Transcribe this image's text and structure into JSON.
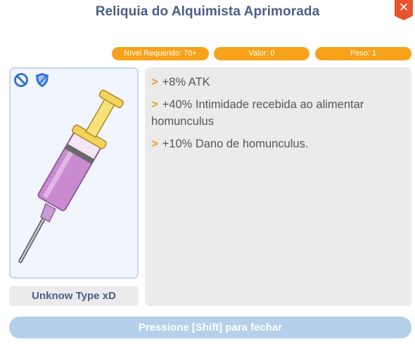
{
  "window": {
    "title": "Reliquia do Alquimista Aprimorada",
    "close_icon": "close-icon",
    "close_glyph": "✕"
  },
  "stats": {
    "required_level": "Nível Requerido: 70+",
    "value": "Valor: 0",
    "weight": "Peso: 1"
  },
  "item": {
    "image": "syringe-icon",
    "badges": [
      "no-trade-icon",
      "shield-icon"
    ],
    "type": "Unknow Type xD"
  },
  "description": {
    "bullet": ">",
    "effects": [
      "+8% ATK",
      "+40% Intimidade recebida ao alimentar homunculus",
      "+10% Dano de homunculus."
    ]
  },
  "footer": {
    "hint": "Pressione [Shift] para fechar"
  },
  "colors": {
    "title": "#4a5f86",
    "accent": "#f7a21a",
    "close": "#e8542c",
    "panel": "#ebebeb",
    "hint_button": "#b4d0ea"
  }
}
